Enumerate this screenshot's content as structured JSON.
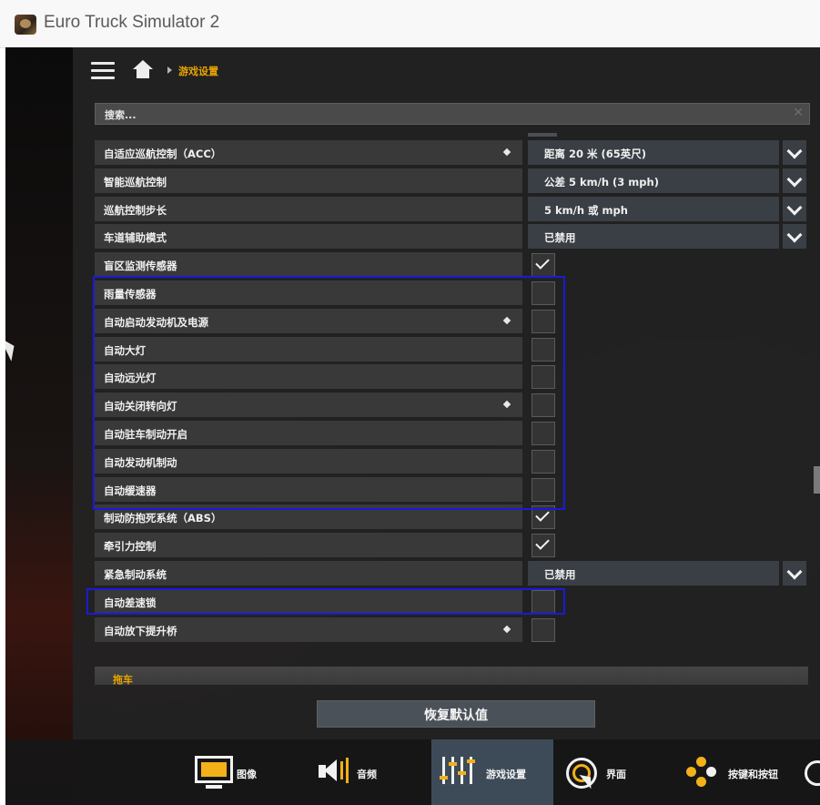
{
  "window": {
    "title": "Euro Truck Simulator 2"
  },
  "header": {
    "breadcrumb": "游戏设置"
  },
  "search": {
    "placeholder": "搜索..."
  },
  "settings": [
    {
      "label": "自适应巡航控制（ACC）",
      "type": "dropdown",
      "value": "距离 20 米 (65英尺)",
      "info": true
    },
    {
      "label": "智能巡航控制",
      "type": "dropdown",
      "value": "公差 5 km/h (3 mph)",
      "info": false
    },
    {
      "label": "巡航控制步长",
      "type": "dropdown",
      "value": "5 km/h 或 mph",
      "info": false
    },
    {
      "label": "车道辅助模式",
      "type": "dropdown",
      "value": "已禁用",
      "info": false
    },
    {
      "label": "盲区监测传感器",
      "type": "checkbox",
      "checked": true,
      "info": false
    },
    {
      "label": "雨量传感器",
      "type": "checkbox",
      "checked": false,
      "info": false
    },
    {
      "label": "自动启动发动机及电源",
      "type": "checkbox",
      "checked": false,
      "info": true
    },
    {
      "label": "自动大灯",
      "type": "checkbox",
      "checked": false,
      "info": false
    },
    {
      "label": "自动远光灯",
      "type": "checkbox",
      "checked": false,
      "info": false
    },
    {
      "label": "自动关闭转向灯",
      "type": "checkbox",
      "checked": false,
      "info": true
    },
    {
      "label": "自动驻车制动开启",
      "type": "checkbox",
      "checked": false,
      "info": false
    },
    {
      "label": "自动发动机制动",
      "type": "checkbox",
      "checked": false,
      "info": false
    },
    {
      "label": "自动缓速器",
      "type": "checkbox",
      "checked": false,
      "info": false
    },
    {
      "label": "制动防抱死系统（ABS）",
      "type": "checkbox",
      "checked": true,
      "info": false
    },
    {
      "label": "牵引力控制",
      "type": "checkbox",
      "checked": true,
      "info": false
    },
    {
      "label": "紧急制动系统",
      "type": "dropdown",
      "value": "已禁用",
      "info": false
    },
    {
      "label": "自动差速锁",
      "type": "checkbox",
      "checked": false,
      "info": false
    },
    {
      "label": "自动放下提升桥",
      "type": "checkbox",
      "checked": false,
      "info": true
    }
  ],
  "section_next": "拖车",
  "reset_button": "恢复默认值",
  "bottom_nav": [
    {
      "label": "图像",
      "icon": "monitor-icon",
      "active": false
    },
    {
      "label": "音频",
      "icon": "speaker-icon",
      "active": false
    },
    {
      "label": "游戏设置",
      "icon": "sliders-icon",
      "active": true
    },
    {
      "label": "界面",
      "icon": "cursor-target-icon",
      "active": false
    },
    {
      "label": "按键和按钮",
      "icon": "gamepad-buttons-icon",
      "active": false
    }
  ],
  "colors": {
    "accent": "#f3b019",
    "panel": "#222222",
    "row": "#393939",
    "dropdown": "#3a3f45",
    "highlight_box": "#1a1ad8"
  }
}
